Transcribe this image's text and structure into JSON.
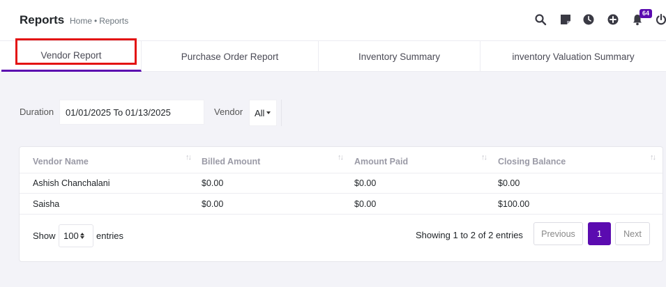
{
  "header": {
    "title": "Reports",
    "breadcrumb": [
      "Home",
      "Reports"
    ],
    "breadcrumb_separator": "•",
    "notification_count": "64",
    "icons": [
      "search-icon",
      "sticky-note-icon",
      "clock-icon",
      "plus-circle-icon",
      "bell-icon",
      "power-icon"
    ]
  },
  "tabs": [
    {
      "label": "Vendor Report",
      "active": true
    },
    {
      "label": "Purchase Order Report",
      "active": false
    },
    {
      "label": "Inventory Summary",
      "active": false
    },
    {
      "label": "inventory Valuation Summary",
      "active": false
    }
  ],
  "filters": {
    "duration_label": "Duration",
    "duration_value": "01/01/2025 To 01/13/2025",
    "vendor_label": "Vendor",
    "vendor_value": "All"
  },
  "table": {
    "columns": [
      "Vendor Name",
      "Billed Amount",
      "Amount Paid",
      "Closing Balance"
    ],
    "rows": [
      [
        "Ashish Chanchalani",
        "$0.00",
        "$0.00",
        "$0.00"
      ],
      [
        "Saisha",
        "$0.00",
        "$0.00",
        "$100.00"
      ]
    ]
  },
  "footer": {
    "show_label": "Show",
    "page_length": "100",
    "entries_label": "entries",
    "info": "Showing 1 to 2 of 2 entries",
    "previous_label": "Previous",
    "current_page": "1",
    "next_label": "Next"
  },
  "colors": {
    "accent": "#5b0bb0",
    "highlight": "#e31414"
  }
}
